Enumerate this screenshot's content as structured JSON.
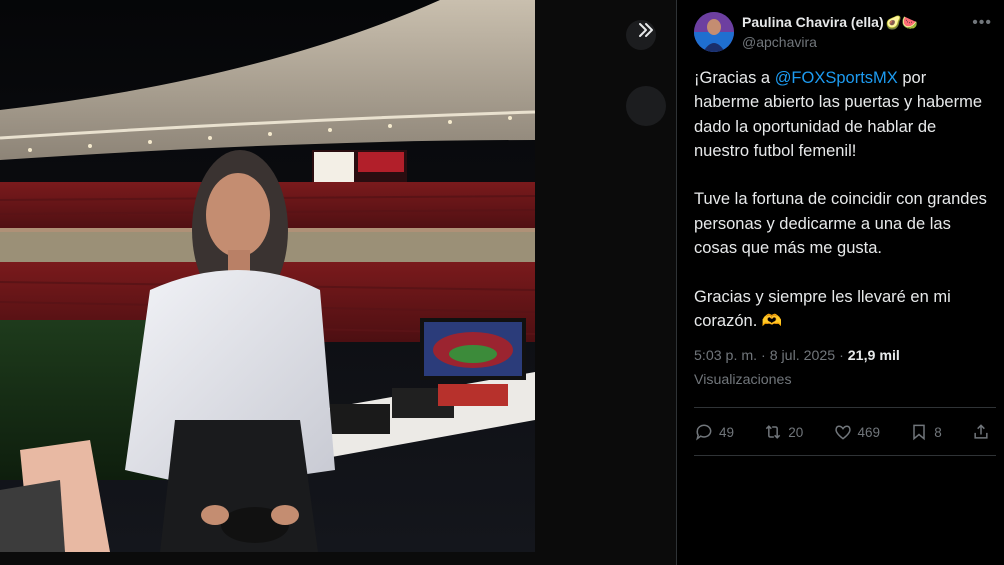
{
  "viewer": {
    "expand_icon": "chevron-double-right-icon"
  },
  "tweet": {
    "author": {
      "display_name": "Paulina Chavira (ella)",
      "emojis": "🥑🍉",
      "handle": "@apchavira"
    },
    "text": {
      "p1_start": "¡Gracias a ",
      "mention": "@FOXSportsMX",
      "p1_end": " por haberme abierto las puertas y haberme dado la oportunidad de hablar de nuestro futbol femenil!",
      "p2": "Tuve la fortuna de coincidir con grandes personas y dedicarme a una de las cosas que más me gusta.",
      "p3": "Gracias y siempre les llevaré en mi corazón. ",
      "heart_hands": "🫶"
    },
    "time": "5:03 p. m.",
    "date": "8 jul. 2025",
    "views_count": "21,9 mil",
    "views_label": "Visualizaciones",
    "actions": {
      "replies": "49",
      "reposts": "20",
      "likes": "469",
      "bookmarks": "8"
    }
  },
  "colors": {
    "accent": "#1d9bf0",
    "muted": "#71767b",
    "text": "#e7e9ea",
    "border": "#2f3336"
  }
}
